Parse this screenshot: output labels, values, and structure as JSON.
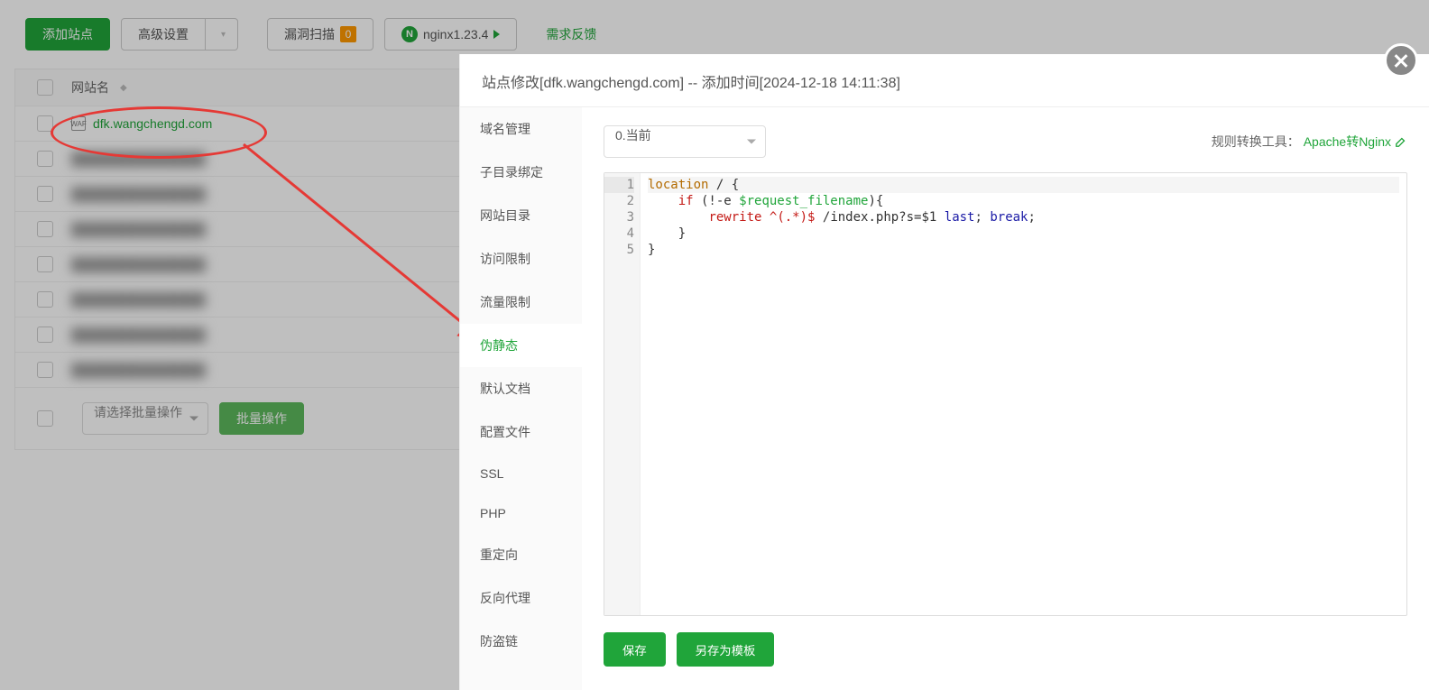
{
  "toolbar": {
    "add_site": "添加站点",
    "advanced": "高级设置",
    "scan": "漏洞扫描",
    "scan_badge": "0",
    "nginx": "nginx1.23.4",
    "feedback": "需求反馈"
  },
  "table": {
    "site_header": "网站名",
    "first_site": "dfk.wangchengd.com",
    "batch_placeholder": "请选择批量操作",
    "batch_button": "批量操作",
    "blur_rows": [
      1,
      2,
      3,
      4,
      5,
      6,
      7
    ]
  },
  "modal": {
    "title": "站点修改[dfk.wangchengd.com] -- 添加时间[2024-12-18 14:11:38]",
    "tabs": [
      "域名管理",
      "子目录绑定",
      "网站目录",
      "访问限制",
      "流量限制",
      "伪静态",
      "默认文档",
      "配置文件",
      "SSL",
      "PHP",
      "重定向",
      "反向代理",
      "防盗链"
    ],
    "active_tab": 5,
    "template_selector": "0.当前",
    "convert_label": "规则转换工具：",
    "convert_link": "Apache转Nginx",
    "save": "保存",
    "save_as": "另存为模板"
  },
  "code": {
    "lines": [
      {
        "n": 1,
        "parts": [
          {
            "t": "location",
            "c": "kw"
          },
          {
            "t": " / {",
            "c": ""
          }
        ]
      },
      {
        "n": 2,
        "parts": [
          {
            "t": "    ",
            "c": ""
          },
          {
            "t": "if",
            "c": "kw2"
          },
          {
            "t": " (!-e ",
            "c": ""
          },
          {
            "t": "$request_filename",
            "c": "var"
          },
          {
            "t": "){",
            "c": ""
          }
        ]
      },
      {
        "n": 3,
        "parts": [
          {
            "t": "        ",
            "c": ""
          },
          {
            "t": "rewrite",
            "c": "kw2"
          },
          {
            "t": " ",
            "c": ""
          },
          {
            "t": "^(.*)$",
            "c": "fn"
          },
          {
            "t": " /index.php?s=$1 ",
            "c": ""
          },
          {
            "t": "last",
            "c": "lit"
          },
          {
            "t": "; ",
            "c": ""
          },
          {
            "t": "break",
            "c": "lit"
          },
          {
            "t": ";",
            "c": ""
          }
        ]
      },
      {
        "n": 4,
        "parts": [
          {
            "t": "    }",
            "c": ""
          }
        ]
      },
      {
        "n": 5,
        "parts": [
          {
            "t": "}",
            "c": ""
          }
        ]
      }
    ]
  }
}
